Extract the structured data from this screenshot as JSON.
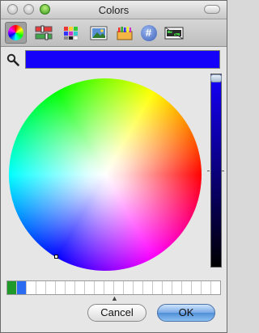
{
  "window": {
    "title": "Colors"
  },
  "toolbar": {
    "buttons": [
      {
        "name": "color-wheel",
        "icon": "color-wheel-icon",
        "active": true
      },
      {
        "name": "color-sliders",
        "icon": "sliders-icon",
        "active": false
      },
      {
        "name": "color-palettes",
        "icon": "palette-grid-icon",
        "active": false
      },
      {
        "name": "image-palettes",
        "icon": "image-icon",
        "active": false
      },
      {
        "name": "crayons",
        "icon": "crayons-icon",
        "active": false
      },
      {
        "name": "hex-input",
        "icon": "hash-icon",
        "label": "#",
        "active": false
      },
      {
        "name": "spectrum",
        "icon": "spectrum-icon",
        "active": false
      }
    ]
  },
  "selected_color": "#1500FA",
  "brightness": 1.0,
  "saved_swatches": [
    "#1f9a2a",
    "#2a6bf2"
  ],
  "buttons": {
    "cancel": "Cancel",
    "ok": "OK"
  }
}
